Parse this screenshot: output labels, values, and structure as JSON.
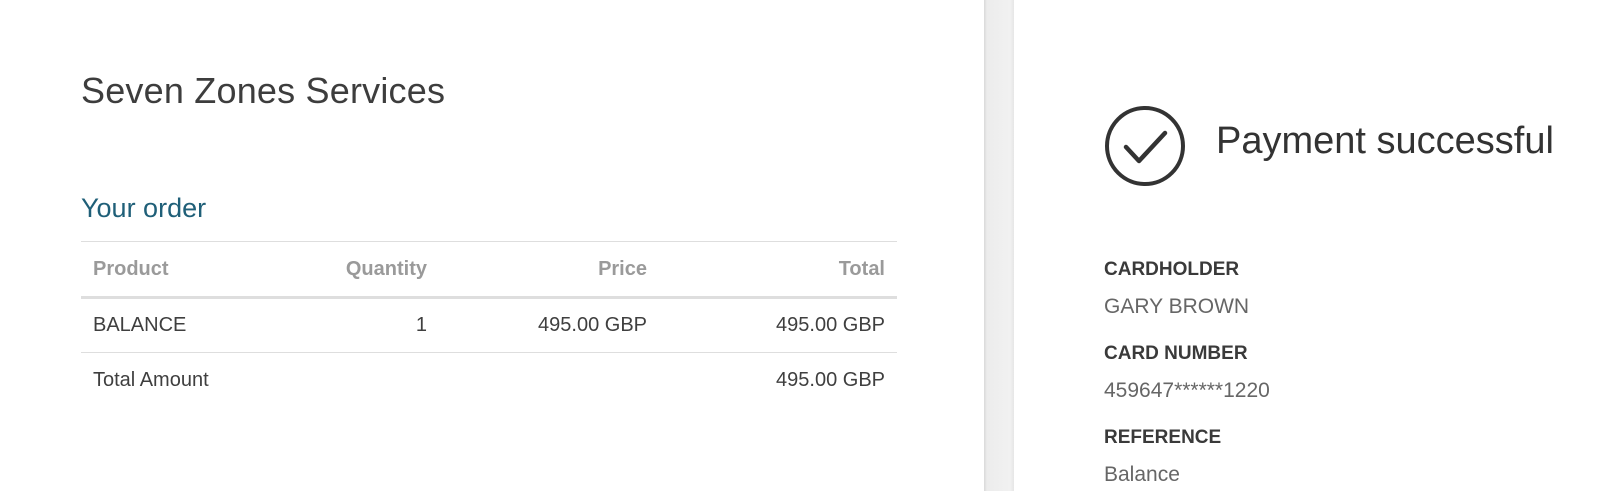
{
  "merchant": {
    "name": "Seven Zones Services"
  },
  "order": {
    "heading": "Your order",
    "columns": {
      "product": "Product",
      "quantity": "Quantity",
      "price": "Price",
      "total": "Total"
    },
    "items": [
      {
        "product": "BALANCE",
        "quantity": "1",
        "price": "495.00 GBP",
        "total": "495.00 GBP"
      }
    ],
    "total_label": "Total Amount",
    "total_value": "495.00 GBP"
  },
  "payment": {
    "status_icon": "checkmark-circle-icon",
    "status": "Payment successful",
    "cardholder_label": "CARDHOLDER",
    "cardholder": "GARY BROWN",
    "card_number_label": "CARD NUMBER",
    "card_number": "459647******1220",
    "reference_label": "REFERENCE",
    "reference": "Balance"
  },
  "colors": {
    "accent": "#1f5f78",
    "text": "#3d3d3d",
    "muted": "#9a9a9a"
  }
}
